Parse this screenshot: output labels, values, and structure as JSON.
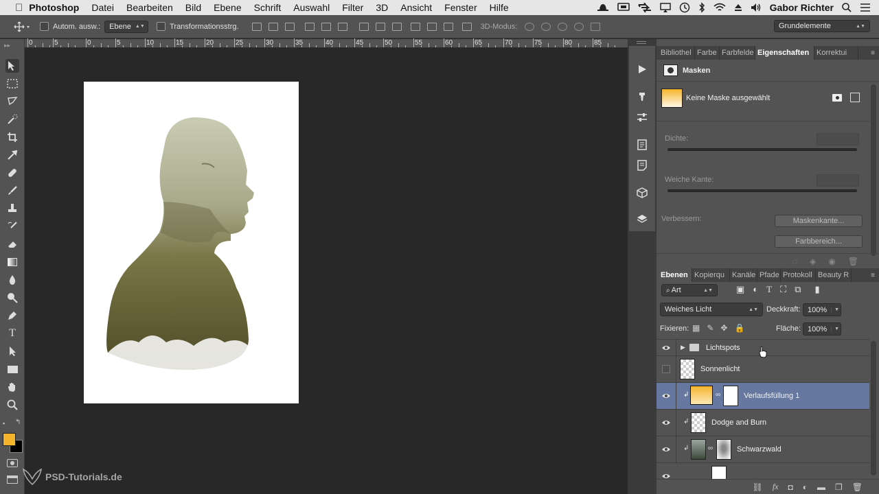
{
  "menubar": {
    "apple_icon": "apple-logo",
    "app_name": "Photoshop",
    "items": [
      "Datei",
      "Bearbeiten",
      "Bild",
      "Ebene",
      "Schrift",
      "Auswahl",
      "Filter",
      "3D",
      "Ansicht",
      "Fenster",
      "Hilfe"
    ],
    "user": "Gabor Richter"
  },
  "options_bar": {
    "auto_select_label": "Autom. ausw.:",
    "auto_select_value": "Ebene",
    "transform_label": "Transformationsstrg.",
    "mode_3d_label": "3D-Modus:",
    "workspace": "Grundelemente"
  },
  "ruler": {
    "ticks": [
      "0",
      "5",
      "0",
      "5",
      "10",
      "15",
      "20",
      "25",
      "30",
      "35",
      "40",
      "45",
      "50",
      "55",
      "60",
      "65",
      "70",
      "75",
      "80",
      "85"
    ]
  },
  "colors": {
    "foreground": "#f4b52c",
    "background": "#000000",
    "selected_layer": "#6678a0",
    "panel": "#535353"
  },
  "properties_panel": {
    "tabs": [
      "Bibliothel",
      "Farbe",
      "Farbfelde",
      "Eigenschaften",
      "Korrektui"
    ],
    "active_tab": "Eigenschaften",
    "section_title": "Masken",
    "mask_status": "Keine Maske ausgewählt",
    "density_label": "Dichte:",
    "feather_label": "Weiche Kante:",
    "refine_label": "Verbessern:",
    "mask_edge_button": "Maskenkante...",
    "color_range_button": "Farbbereich..."
  },
  "layers_panel": {
    "tabs": [
      "Ebenen",
      "Kopierqu",
      "Kanäle",
      "Pfade",
      "Protokoll",
      "Beauty R"
    ],
    "active_tab": "Ebenen",
    "filter_value": "Art",
    "blend_mode": "Weiches Licht",
    "opacity_label": "Deckkraft:",
    "opacity_value": "100%",
    "lock_label": "Fixieren:",
    "fill_label": "Fläche:",
    "fill_value": "100%",
    "layers": [
      {
        "name": "Lichtspots",
        "visible": true,
        "type": "group"
      },
      {
        "name": "Sonnenlicht",
        "visible": false,
        "type": "layer"
      },
      {
        "name": "Verlaufsfüllung 1",
        "visible": true,
        "type": "fill",
        "selected": true
      },
      {
        "name": "Dodge and Burn",
        "visible": true,
        "type": "layer"
      },
      {
        "name": "Schwarzwald",
        "visible": true,
        "type": "layer"
      }
    ]
  },
  "watermark": "PSD-Tutorials.de"
}
